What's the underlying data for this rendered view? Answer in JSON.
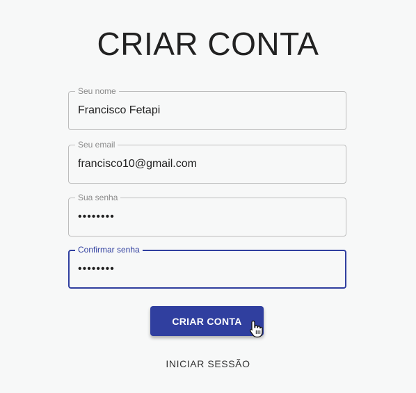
{
  "form": {
    "title": "CRIAR CONTA",
    "fields": [
      {
        "label": "Seu nome",
        "value": "Francisco Fetapi"
      },
      {
        "label": "Seu email",
        "value": "francisco10@gmail.com"
      },
      {
        "label": "Sua senha",
        "value": "••••••••"
      },
      {
        "label": "Confirmar senha",
        "value": "••••••••"
      }
    ],
    "submit_label": "CRIAR CONTA",
    "login_label": "INICIAR SESSÃO"
  },
  "colors": {
    "primary": "#303f9f",
    "background": "#f7f8f8"
  },
  "icons": {
    "cursor": "hand-pointer-icon"
  }
}
